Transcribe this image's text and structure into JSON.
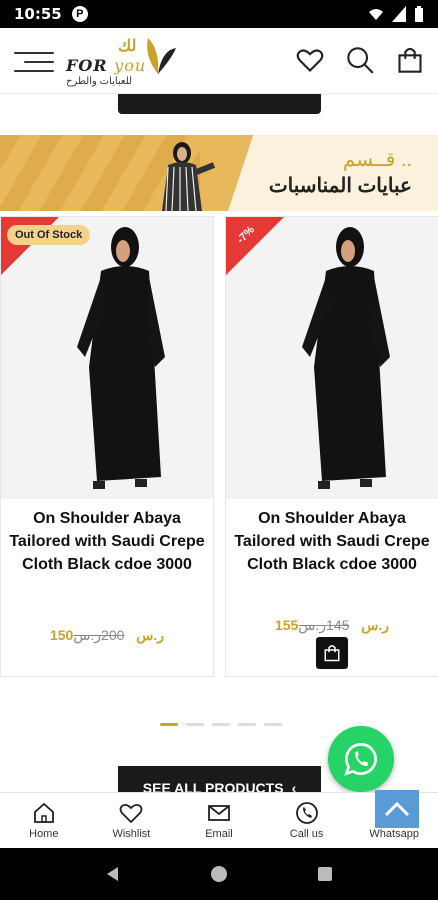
{
  "status_bar": {
    "time": "10:55",
    "badge": "P"
  },
  "header": {
    "logo_en_a": "FOR ",
    "logo_en_b": "you",
    "logo_ar": "للعبايات والطرح",
    "logo_ar_big": "لك"
  },
  "banner": {
    "line1": "قــسم ..",
    "line2": "عبايات المناسبات"
  },
  "products": [
    {
      "name": "On Shoulder Abaya Tailored with Saudi Crepe Cloth Black cdoe 3000",
      "badge": "Out Of Stock",
      "old_price": "200ر.س",
      "new_price": "150ر.س"
    },
    {
      "name": "On Shoulder Abaya Tailored with Saudi Crepe Cloth Black cdoe 3000",
      "badge": "-7%",
      "old_price": "145ر.س",
      "new_price": "155ر.س"
    }
  ],
  "see_all_label": "SEE ALL PRODUCTS",
  "bottom_nav": {
    "home": "Home",
    "wishlist": "Wishlist",
    "email": "Email",
    "call": "Call us",
    "whatsapp": "Whatsapp"
  },
  "colors": {
    "accent": "#c9a227",
    "sale": "#e53935",
    "whatsapp": "#25d366"
  }
}
